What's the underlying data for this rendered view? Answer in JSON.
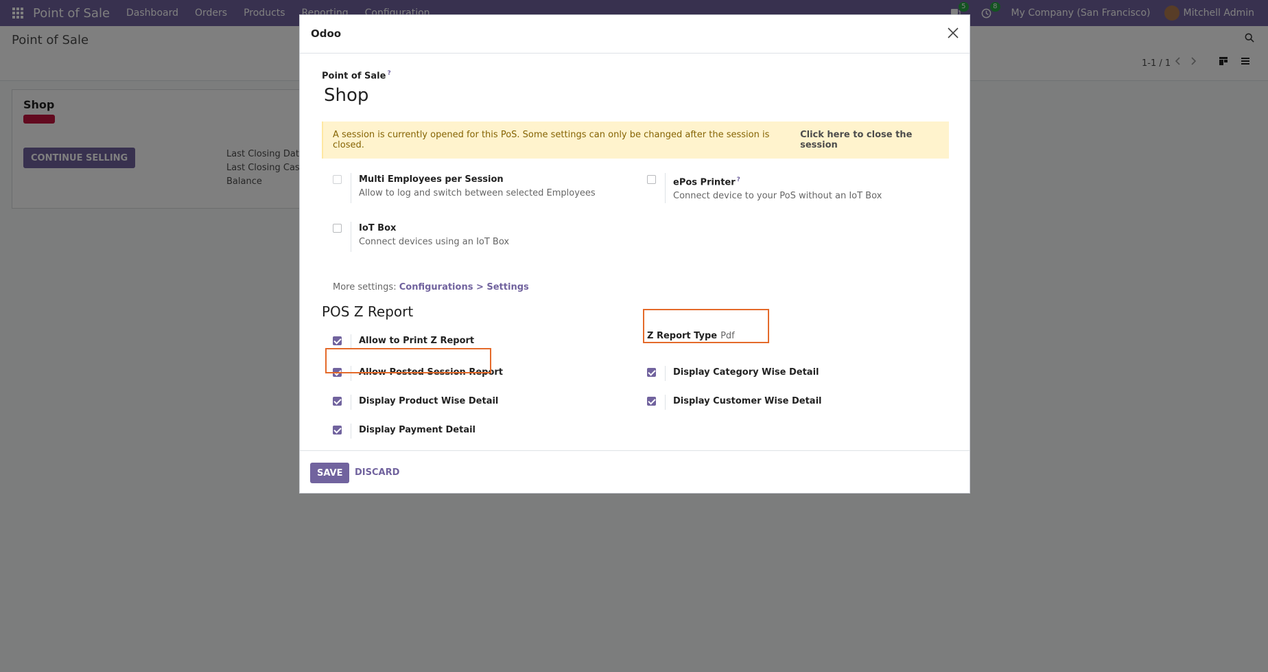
{
  "navbar": {
    "brand": "Point of Sale",
    "menu": [
      "Dashboard",
      "Orders",
      "Products",
      "Reporting",
      "Configuration"
    ],
    "messages_count": "5",
    "activities_count": "8",
    "company": "My Company (San Francisco)",
    "user": "Mitchell Admin"
  },
  "control_panel": {
    "title": "Point of Sale",
    "pager": "1-1 / 1"
  },
  "kanban": {
    "title": "Shop",
    "badge": "Closing",
    "continue_button": "CONTINUE SELLING",
    "info": [
      "Last Closing Date",
      "Last Closing Cash",
      "Balance"
    ]
  },
  "modal": {
    "title": "Odoo",
    "field_label": "Point of Sale",
    "help_mark": "?",
    "name": "Shop",
    "alert_text": "A session is currently opened for this PoS. Some settings can only be changed after the session is closed.",
    "alert_link": "Click here to close the session",
    "settings": [
      {
        "title": "Multi Employees per Session",
        "desc": "Allow to log and switch between selected Employees",
        "checked": false
      },
      {
        "title": "ePos Printer",
        "desc": "Connect device to your PoS without an IoT Box",
        "checked": false
      },
      {
        "title": "IoT Box",
        "desc": "Connect devices using an IoT Box",
        "checked": false
      }
    ],
    "more_settings_prefix": "More settings:",
    "more_settings_link": "Configurations > Settings",
    "section_title": "POS Z Report",
    "zreport_type_label": "Z Report Type",
    "zreport_type_value": "Pdf",
    "zreport_options": [
      {
        "title": "Allow to Print Z Report",
        "checked": true
      },
      {
        "title": "Allow Posted Session Report",
        "checked": true
      },
      {
        "title": "Display Category Wise Detail",
        "checked": true
      },
      {
        "title": "Display Product Wise Detail",
        "checked": true
      },
      {
        "title": "Display Customer Wise Detail",
        "checked": true
      },
      {
        "title": "Display Payment Detail",
        "checked": true
      }
    ],
    "save_label": "SAVE",
    "discard_label": "DISCARD"
  },
  "colors": {
    "brand": "#71639e",
    "highlight": "#e46a2a",
    "alert_bg": "#fff3cd",
    "alert_text": "#856404"
  }
}
